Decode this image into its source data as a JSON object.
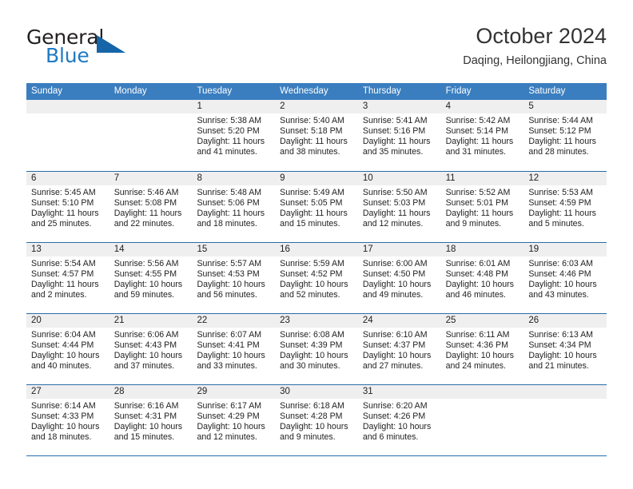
{
  "brand": {
    "name_top": "General",
    "name_bottom": "Blue",
    "accent_color": "#1565a8",
    "text_color": "#231f20"
  },
  "header": {
    "title": "October 2024",
    "subtitle": "Daqing, Heilongjiang, China"
  },
  "calendar": {
    "header_bg": "#3a7ebf",
    "row_divider_color": "#2b6ca8",
    "day_head_bg": "#efefef",
    "weekdays": [
      "Sunday",
      "Monday",
      "Tuesday",
      "Wednesday",
      "Thursday",
      "Friday",
      "Saturday"
    ],
    "weeks": [
      [
        {
          "day": "",
          "sunrise": "",
          "sunset": "",
          "daylight": ""
        },
        {
          "day": "",
          "sunrise": "",
          "sunset": "",
          "daylight": ""
        },
        {
          "day": "1",
          "sunrise": "Sunrise: 5:38 AM",
          "sunset": "Sunset: 5:20 PM",
          "daylight": "Daylight: 11 hours and 41 minutes."
        },
        {
          "day": "2",
          "sunrise": "Sunrise: 5:40 AM",
          "sunset": "Sunset: 5:18 PM",
          "daylight": "Daylight: 11 hours and 38 minutes."
        },
        {
          "day": "3",
          "sunrise": "Sunrise: 5:41 AM",
          "sunset": "Sunset: 5:16 PM",
          "daylight": "Daylight: 11 hours and 35 minutes."
        },
        {
          "day": "4",
          "sunrise": "Sunrise: 5:42 AM",
          "sunset": "Sunset: 5:14 PM",
          "daylight": "Daylight: 11 hours and 31 minutes."
        },
        {
          "day": "5",
          "sunrise": "Sunrise: 5:44 AM",
          "sunset": "Sunset: 5:12 PM",
          "daylight": "Daylight: 11 hours and 28 minutes."
        }
      ],
      [
        {
          "day": "6",
          "sunrise": "Sunrise: 5:45 AM",
          "sunset": "Sunset: 5:10 PM",
          "daylight": "Daylight: 11 hours and 25 minutes."
        },
        {
          "day": "7",
          "sunrise": "Sunrise: 5:46 AM",
          "sunset": "Sunset: 5:08 PM",
          "daylight": "Daylight: 11 hours and 22 minutes."
        },
        {
          "day": "8",
          "sunrise": "Sunrise: 5:48 AM",
          "sunset": "Sunset: 5:06 PM",
          "daylight": "Daylight: 11 hours and 18 minutes."
        },
        {
          "day": "9",
          "sunrise": "Sunrise: 5:49 AM",
          "sunset": "Sunset: 5:05 PM",
          "daylight": "Daylight: 11 hours and 15 minutes."
        },
        {
          "day": "10",
          "sunrise": "Sunrise: 5:50 AM",
          "sunset": "Sunset: 5:03 PM",
          "daylight": "Daylight: 11 hours and 12 minutes."
        },
        {
          "day": "11",
          "sunrise": "Sunrise: 5:52 AM",
          "sunset": "Sunset: 5:01 PM",
          "daylight": "Daylight: 11 hours and 9 minutes."
        },
        {
          "day": "12",
          "sunrise": "Sunrise: 5:53 AM",
          "sunset": "Sunset: 4:59 PM",
          "daylight": "Daylight: 11 hours and 5 minutes."
        }
      ],
      [
        {
          "day": "13",
          "sunrise": "Sunrise: 5:54 AM",
          "sunset": "Sunset: 4:57 PM",
          "daylight": "Daylight: 11 hours and 2 minutes."
        },
        {
          "day": "14",
          "sunrise": "Sunrise: 5:56 AM",
          "sunset": "Sunset: 4:55 PM",
          "daylight": "Daylight: 10 hours and 59 minutes."
        },
        {
          "day": "15",
          "sunrise": "Sunrise: 5:57 AM",
          "sunset": "Sunset: 4:53 PM",
          "daylight": "Daylight: 10 hours and 56 minutes."
        },
        {
          "day": "16",
          "sunrise": "Sunrise: 5:59 AM",
          "sunset": "Sunset: 4:52 PM",
          "daylight": "Daylight: 10 hours and 52 minutes."
        },
        {
          "day": "17",
          "sunrise": "Sunrise: 6:00 AM",
          "sunset": "Sunset: 4:50 PM",
          "daylight": "Daylight: 10 hours and 49 minutes."
        },
        {
          "day": "18",
          "sunrise": "Sunrise: 6:01 AM",
          "sunset": "Sunset: 4:48 PM",
          "daylight": "Daylight: 10 hours and 46 minutes."
        },
        {
          "day": "19",
          "sunrise": "Sunrise: 6:03 AM",
          "sunset": "Sunset: 4:46 PM",
          "daylight": "Daylight: 10 hours and 43 minutes."
        }
      ],
      [
        {
          "day": "20",
          "sunrise": "Sunrise: 6:04 AM",
          "sunset": "Sunset: 4:44 PM",
          "daylight": "Daylight: 10 hours and 40 minutes."
        },
        {
          "day": "21",
          "sunrise": "Sunrise: 6:06 AM",
          "sunset": "Sunset: 4:43 PM",
          "daylight": "Daylight: 10 hours and 37 minutes."
        },
        {
          "day": "22",
          "sunrise": "Sunrise: 6:07 AM",
          "sunset": "Sunset: 4:41 PM",
          "daylight": "Daylight: 10 hours and 33 minutes."
        },
        {
          "day": "23",
          "sunrise": "Sunrise: 6:08 AM",
          "sunset": "Sunset: 4:39 PM",
          "daylight": "Daylight: 10 hours and 30 minutes."
        },
        {
          "day": "24",
          "sunrise": "Sunrise: 6:10 AM",
          "sunset": "Sunset: 4:37 PM",
          "daylight": "Daylight: 10 hours and 27 minutes."
        },
        {
          "day": "25",
          "sunrise": "Sunrise: 6:11 AM",
          "sunset": "Sunset: 4:36 PM",
          "daylight": "Daylight: 10 hours and 24 minutes."
        },
        {
          "day": "26",
          "sunrise": "Sunrise: 6:13 AM",
          "sunset": "Sunset: 4:34 PM",
          "daylight": "Daylight: 10 hours and 21 minutes."
        }
      ],
      [
        {
          "day": "27",
          "sunrise": "Sunrise: 6:14 AM",
          "sunset": "Sunset: 4:33 PM",
          "daylight": "Daylight: 10 hours and 18 minutes."
        },
        {
          "day": "28",
          "sunrise": "Sunrise: 6:16 AM",
          "sunset": "Sunset: 4:31 PM",
          "daylight": "Daylight: 10 hours and 15 minutes."
        },
        {
          "day": "29",
          "sunrise": "Sunrise: 6:17 AM",
          "sunset": "Sunset: 4:29 PM",
          "daylight": "Daylight: 10 hours and 12 minutes."
        },
        {
          "day": "30",
          "sunrise": "Sunrise: 6:18 AM",
          "sunset": "Sunset: 4:28 PM",
          "daylight": "Daylight: 10 hours and 9 minutes."
        },
        {
          "day": "31",
          "sunrise": "Sunrise: 6:20 AM",
          "sunset": "Sunset: 4:26 PM",
          "daylight": "Daylight: 10 hours and 6 minutes."
        },
        {
          "day": "",
          "sunrise": "",
          "sunset": "",
          "daylight": ""
        },
        {
          "day": "",
          "sunrise": "",
          "sunset": "",
          "daylight": ""
        }
      ]
    ]
  }
}
